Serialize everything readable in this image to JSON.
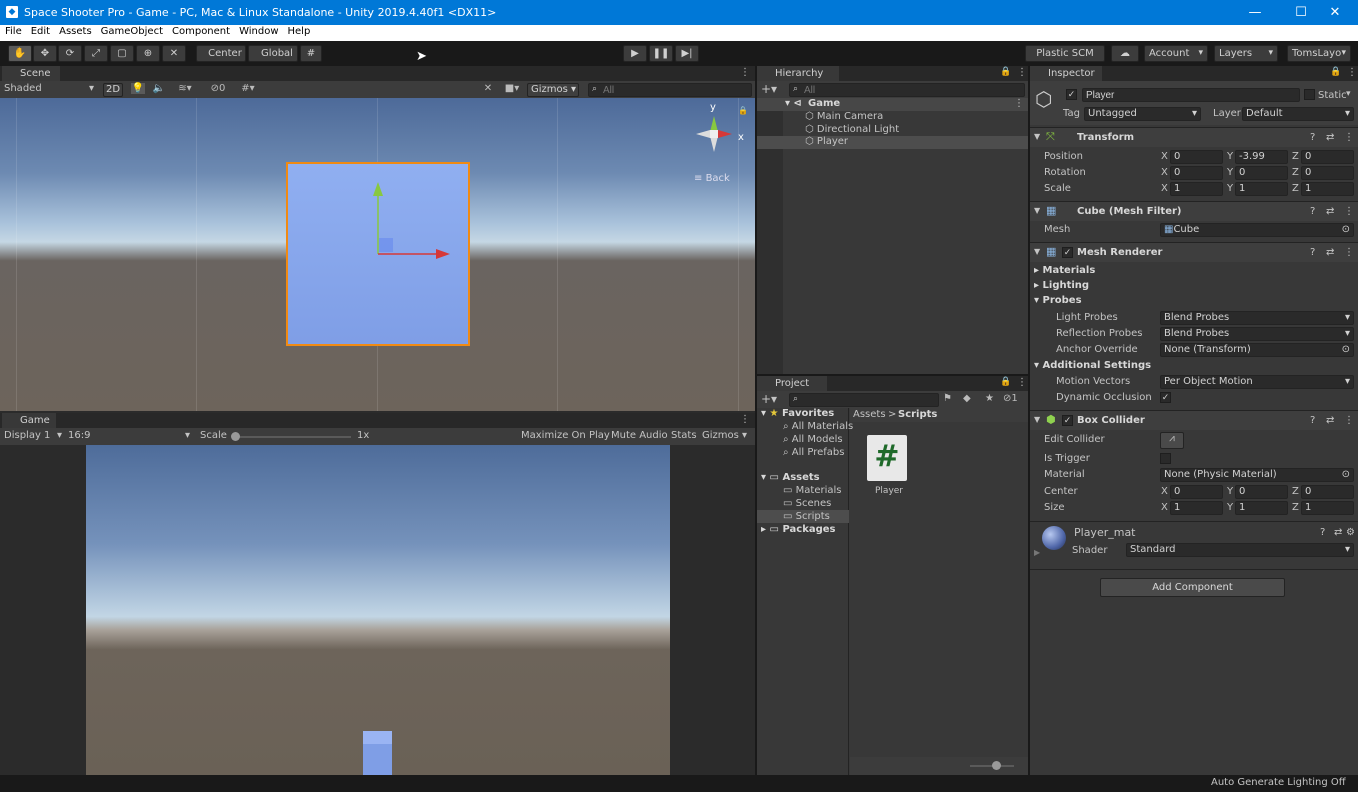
{
  "window": {
    "title": "Space Shooter Pro - Game - PC, Mac & Linux Standalone - Unity 2019.4.40f1 <DX11>",
    "minimize": "—",
    "maximize": "☐",
    "close": "✕"
  },
  "menu": [
    "File",
    "Edit",
    "Assets",
    "GameObject",
    "Component",
    "Window",
    "Help"
  ],
  "toolbar": {
    "center": "Center",
    "global": "Global",
    "plastic": "Plastic SCM",
    "account": "Account",
    "layers": "Layers",
    "layout": "TomsLayo"
  },
  "scene": {
    "tab": "Scene",
    "shading": "Shaded",
    "mode2d": "2D",
    "hidden_count": "0",
    "gizmos": "Gizmos",
    "search_placeholder": "All",
    "back_label": "Back",
    "axis_y": "y",
    "axis_x": "x"
  },
  "game": {
    "tab": "Game",
    "display": "Display 1",
    "aspect": "16:9",
    "scale_label": "Scale",
    "scale_value": "1x",
    "maximize": "Maximize On Play",
    "mute": "Mute Audio",
    "stats": "Stats",
    "gizmos": "Gizmos"
  },
  "hierarchy": {
    "tab": "Hierarchy",
    "search_placeholder": "All",
    "scene_name": "Game",
    "items": [
      "Main Camera",
      "Directional Light",
      "Player"
    ]
  },
  "project": {
    "tab": "Project",
    "hidden_count": "1",
    "favorites_label": "Favorites",
    "favorites": [
      "All Materials",
      "All Models",
      "All Prefabs"
    ],
    "assets_label": "Assets",
    "assets": [
      "Materials",
      "Scenes",
      "Scripts"
    ],
    "packages": "Packages",
    "breadcrumb": [
      "Assets",
      "Scripts"
    ],
    "file_name": "Player",
    "file_glyph": "#"
  },
  "inspector": {
    "tab": "Inspector",
    "object_name": "Player",
    "static_label": "Static",
    "tag_label": "Tag",
    "tag": "Untagged",
    "layer_label": "Layer",
    "layer": "Default",
    "transform": {
      "title": "Transform",
      "position_label": "Position",
      "rotation_label": "Rotation",
      "scale_label": "Scale",
      "position": {
        "x": "0",
        "y": "-3.99",
        "z": "0"
      },
      "rotation": {
        "x": "0",
        "y": "0",
        "z": "0"
      },
      "scale": {
        "x": "1",
        "y": "1",
        "z": "1"
      }
    },
    "axis_labels": {
      "x": "X",
      "y": "Y",
      "z": "Z"
    },
    "mesh_filter": {
      "title": "Cube (Mesh Filter)",
      "mesh_label": "Mesh",
      "mesh": "Cube"
    },
    "mesh_renderer": {
      "title": "Mesh Renderer",
      "materials": "Materials",
      "lighting": "Lighting",
      "probes": "Probes",
      "light_probes_label": "Light Probes",
      "light_probes": "Blend Probes",
      "reflection_probes_label": "Reflection Probes",
      "reflection_probes": "Blend Probes",
      "anchor_override_label": "Anchor Override",
      "anchor_override": "None (Transform)",
      "additional_settings": "Additional Settings",
      "motion_vectors_label": "Motion Vectors",
      "motion_vectors": "Per Object Motion",
      "dynamic_occlusion_label": "Dynamic Occlusion"
    },
    "box_collider": {
      "title": "Box Collider",
      "edit_collider_label": "Edit Collider",
      "is_trigger_label": "Is Trigger",
      "material_label": "Material",
      "material": "None (Physic Material)",
      "center_label": "Center",
      "size_label": "Size",
      "center": {
        "x": "0",
        "y": "0",
        "z": "0"
      },
      "size": {
        "x": "1",
        "y": "1",
        "z": "1"
      }
    },
    "material": {
      "name": "Player_mat",
      "shader_label": "Shader",
      "shader": "Standard"
    },
    "add_component": "Add Component"
  },
  "status": {
    "lighting": "Auto Generate Lighting Off"
  },
  "colors": {
    "titlebar": "#0078d7",
    "selection_outline": "#f08a13",
    "panel": "#383838"
  }
}
